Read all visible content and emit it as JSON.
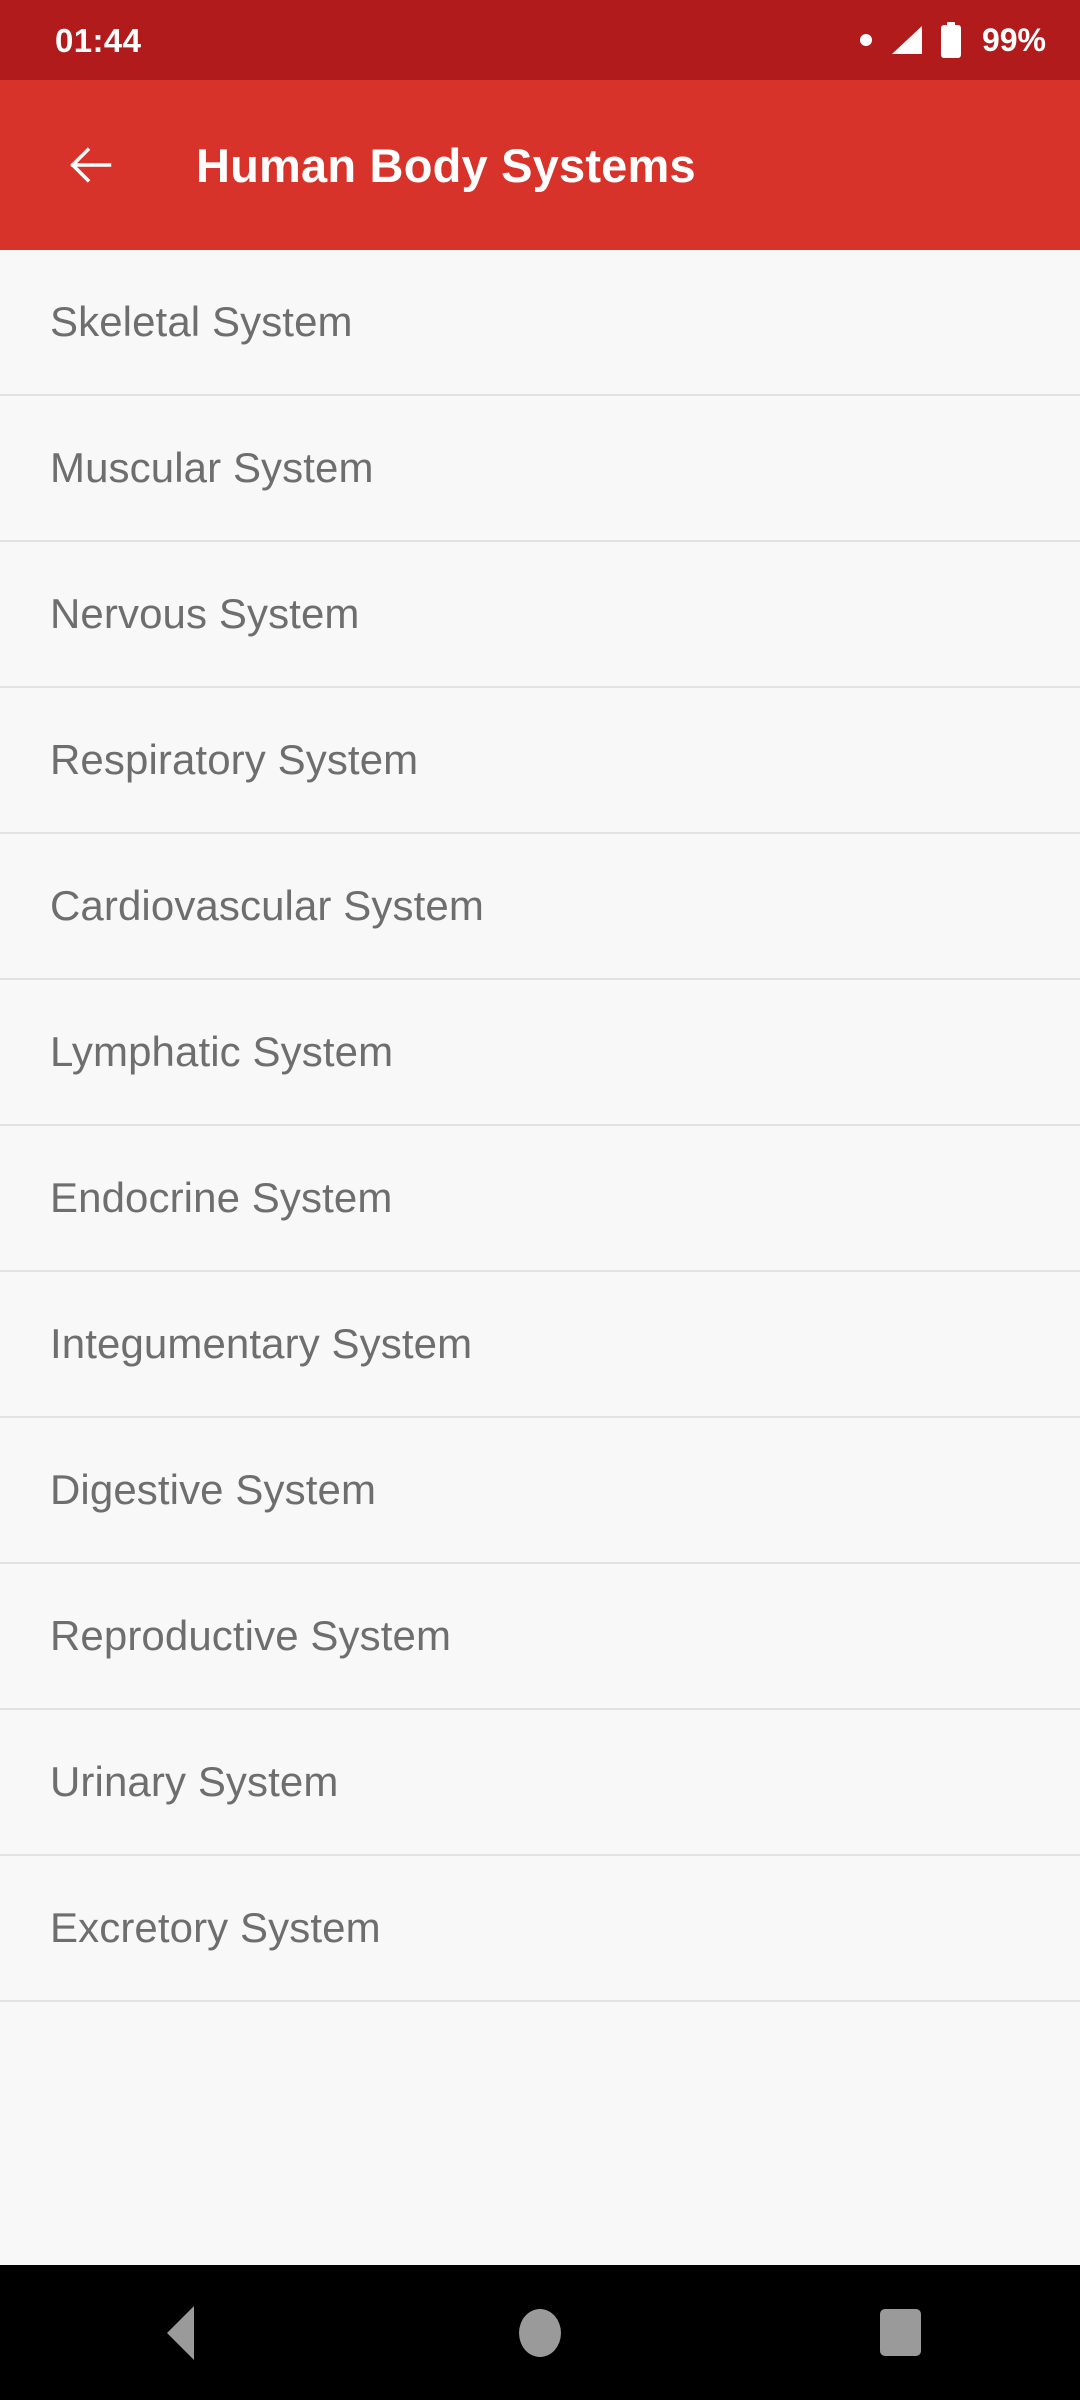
{
  "status_bar": {
    "time": "01:44",
    "battery_percent": "99%",
    "icons": [
      "dot-icon",
      "signal-icon",
      "battery-icon"
    ],
    "background_color": "#b21b1b",
    "text_color": "#ffffff"
  },
  "app_bar": {
    "back_label": "Back",
    "title": "Human Body Systems",
    "background_color": "#d8332b",
    "text_color": "#ffffff"
  },
  "list": {
    "background_color": "#f8f8f8",
    "text_color": "#6e6e6e",
    "divider_color": "#e2e2e2",
    "items": [
      {
        "label": "Skeletal System"
      },
      {
        "label": "Muscular System"
      },
      {
        "label": "Nervous System"
      },
      {
        "label": "Respiratory System"
      },
      {
        "label": "Cardiovascular System"
      },
      {
        "label": "Lymphatic System"
      },
      {
        "label": "Endocrine System"
      },
      {
        "label": "Integumentary System"
      },
      {
        "label": "Digestive System"
      },
      {
        "label": "Reproductive System"
      },
      {
        "label": "Urinary System"
      },
      {
        "label": "Excretory System"
      }
    ]
  },
  "nav_bar": {
    "background_color": "#000000",
    "icon_color": "#9a9a9a",
    "buttons": [
      {
        "name": "back",
        "label": "Back"
      },
      {
        "name": "home",
        "label": "Home"
      },
      {
        "name": "recents",
        "label": "Recents"
      }
    ]
  }
}
